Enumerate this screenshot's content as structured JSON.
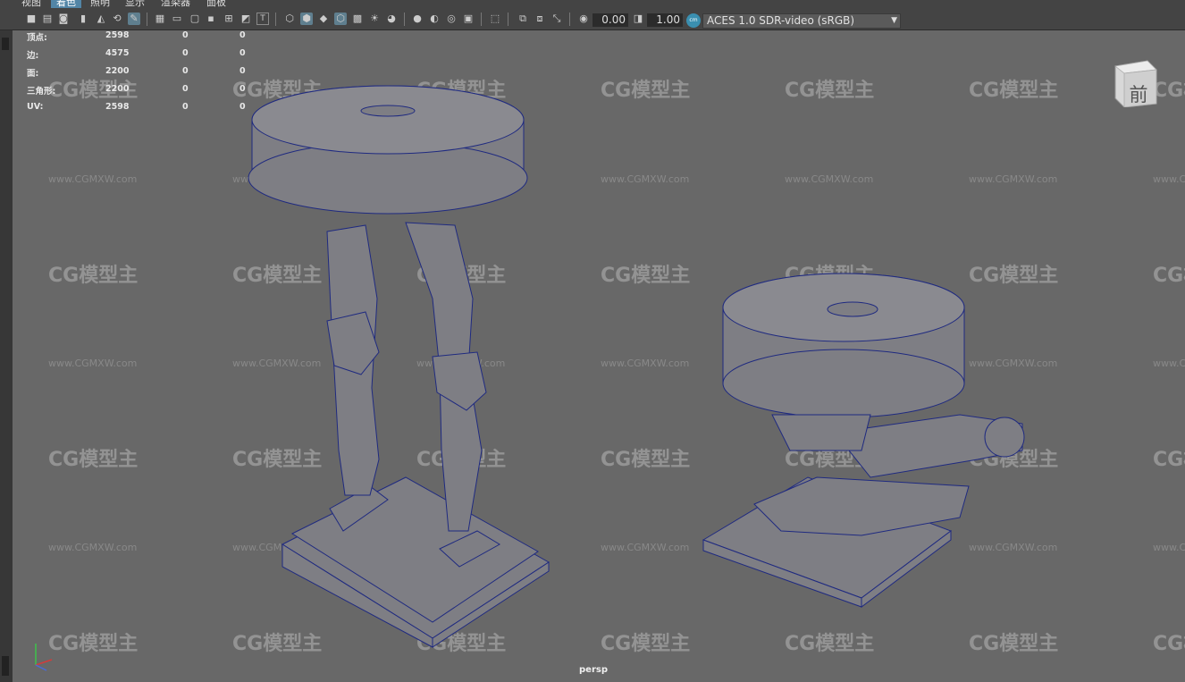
{
  "menubar": {
    "items": [
      "视图",
      "着色",
      "照明",
      "显示",
      "渲染器",
      "面板"
    ],
    "active_index": 1
  },
  "toolbar": {
    "exposure_value": "0.00",
    "gamma_value": "1.00",
    "color_management_icon_label": "cm",
    "color_space": "ACES 1.0 SDR-video (sRGB)"
  },
  "hud": {
    "rows": [
      {
        "label": "顶点:",
        "v1": "2598",
        "v2": "0",
        "v3": "0"
      },
      {
        "label": "边:",
        "v1": "4575",
        "v2": "0",
        "v3": "0"
      },
      {
        "label": "面:",
        "v1": "2200",
        "v2": "0",
        "v3": "0"
      },
      {
        "label": "三角形:",
        "v1": "2200",
        "v2": "0",
        "v3": "0"
      },
      {
        "label": "UV:",
        "v1": "2598",
        "v2": "0",
        "v3": "0"
      }
    ]
  },
  "viewcube": {
    "face_label": "前"
  },
  "camera": {
    "name": "persp"
  },
  "watermark": {
    "logo_text": "CG模型主",
    "url_text": "www.CGMXW.com"
  },
  "colors": {
    "viewport_bg": "#686868",
    "wire": "#1f2a80",
    "mesh_fill": "#7e7e84",
    "accent": "#5285a6"
  }
}
